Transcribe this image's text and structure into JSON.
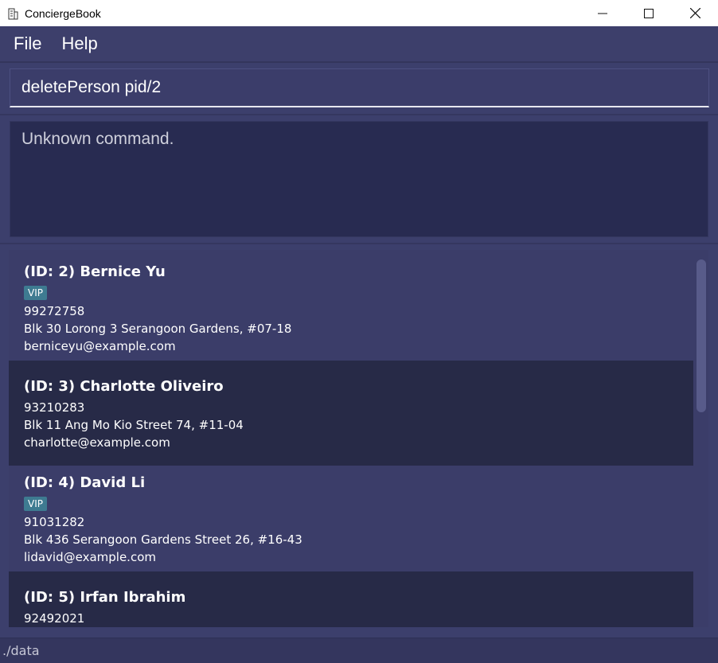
{
  "window": {
    "title": "ConciergeBook",
    "icon": "building-icon"
  },
  "menu": {
    "items": [
      "File",
      "Help"
    ]
  },
  "command": {
    "value": "deletePerson pid/2"
  },
  "result": {
    "text": "Unknown command."
  },
  "persons": [
    {
      "id_name": "(ID: 2) Bernice Yu",
      "tags": [
        "VIP"
      ],
      "phone": "99272758",
      "address": "Blk 30 Lorong 3 Serangoon Gardens, #07-18",
      "email": "berniceyu@example.com"
    },
    {
      "id_name": "(ID: 3) Charlotte Oliveiro",
      "tags": [],
      "phone": "93210283",
      "address": "Blk 11 Ang Mo Kio Street 74, #11-04",
      "email": "charlotte@example.com"
    },
    {
      "id_name": "(ID: 4) David Li",
      "tags": [
        "VIP"
      ],
      "phone": "91031282",
      "address": "Blk 436 Serangoon Gardens Street 26, #16-43",
      "email": "lidavid@example.com"
    },
    {
      "id_name": "(ID: 5) Irfan Ibrahim",
      "tags": [],
      "phone": "92492021",
      "address": "",
      "email": ""
    }
  ],
  "status": {
    "path": "./data"
  },
  "colors": {
    "background": "#3c3f6c",
    "card_alt": "#272a47",
    "tag": "#3e7b91"
  }
}
